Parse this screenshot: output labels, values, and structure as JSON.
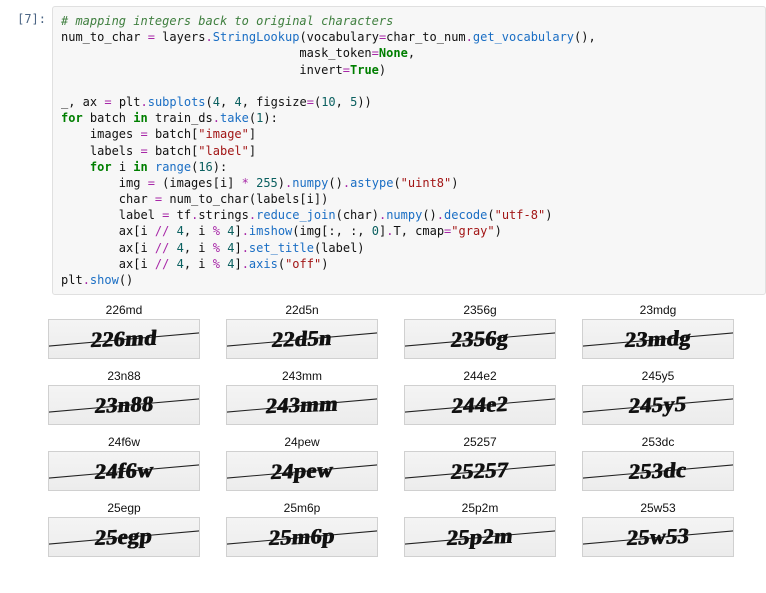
{
  "prompt": "[7]:",
  "code": {
    "l1_comment": "# mapping integers back to original characters",
    "l2_a": "num_to_char ",
    "l2_b": " layers",
    "l2_c": "StringLookup",
    "l2_d": "(vocabulary",
    "l2_e": "char_to_num",
    "l2_f": "get_vocabulary",
    "l2_g": "(),",
    "l3_a": "                                 mask_token",
    "l3_b": "None",
    "l4_a": "                                 invert",
    "l4_b": "True",
    "l6_a": "_, ax ",
    "l6_b": " plt",
    "l6_c": "subplots",
    "l6_d": "4",
    "l6_e": "4",
    "l6_f": "figsize",
    "l6_g": "10",
    "l6_h": "5",
    "l7_a": "for",
    "l7_b": " batch ",
    "l7_c": "in",
    "l7_d": " train_ds",
    "l7_e": "take",
    "l7_f": "1",
    "l8_a": "    images ",
    "l8_b": " batch[",
    "l8_c": "\"image\"",
    "l9_a": "    labels ",
    "l9_b": " batch[",
    "l9_c": "\"label\"",
    "l10_a": "    ",
    "l10_b": "for",
    "l10_c": " i ",
    "l10_d": "in",
    "l10_e": " ",
    "l10_f": "range",
    "l10_g": "16",
    "l11_a": "        img ",
    "l11_b": " (images[i] ",
    "l11_c": "*",
    "l11_d": " ",
    "l11_e": "255",
    "l11_f": ")",
    "l11_g": "numpy",
    "l11_h": "()",
    "l11_i": "astype",
    "l11_j": "\"uint8\"",
    "l12_a": "        char ",
    "l12_b": " num_to_char(labels[i])",
    "l13_a": "        label ",
    "l13_b": " tf",
    "l13_c": "strings",
    "l13_d": "reduce_join",
    "l13_e": "(char)",
    "l13_f": "numpy",
    "l13_g": "()",
    "l13_h": "decode",
    "l13_i": "\"utf-8\"",
    "l14_a": "        ax[i ",
    "l14_b": "//",
    "l14_c": " ",
    "l14_d": "4",
    "l14_e": ", i ",
    "l14_f": "%",
    "l14_g": " ",
    "l14_h": "4",
    "l14_i": "]",
    "l14_j": "imshow",
    "l14_k": "(img[:, :, ",
    "l14_l": "0",
    "l14_m": "]",
    "l14_n": "T, cmap",
    "l14_o": "\"gray\"",
    "l15_j": "set_title",
    "l15_k": "(label)",
    "l16_j": "axis",
    "l16_k": "\"off\"",
    "l17_a": "plt",
    "l17_b": "show",
    "l17_c": "()"
  },
  "labels": [
    "226md",
    "22d5n",
    "2356g",
    "23mdg",
    "23n88",
    "243mm",
    "244e2",
    "245y5",
    "24f6w",
    "24pew",
    "25257",
    "253dc",
    "25egp",
    "25m6p",
    "25p2m",
    "25w53"
  ]
}
